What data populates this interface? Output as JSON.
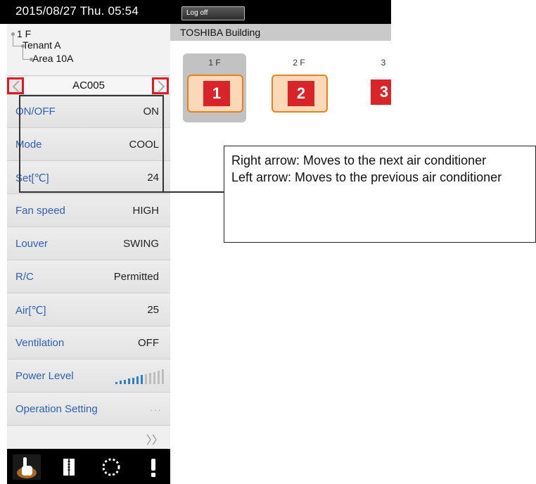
{
  "topbar": {
    "datetime": "2015/08/27  Thu.  05:54",
    "logoff_label": "Log off"
  },
  "tree": {
    "floor": "1 F",
    "tenant": "Tenant A",
    "area": "Area 10A"
  },
  "ac": {
    "name": "AC005",
    "prev_icon": "chevron-left-icon",
    "next_icon": "chevron-right-icon"
  },
  "rows": [
    {
      "label": "ON/OFF",
      "value": "ON"
    },
    {
      "label": "Mode",
      "value": "COOL"
    },
    {
      "label": "Set[℃]",
      "value": "24"
    },
    {
      "label": "Fan speed",
      "value": "HIGH"
    },
    {
      "label": "Louver",
      "value": "SWING"
    },
    {
      "label": "R/C",
      "value": "Permitted"
    },
    {
      "label": "Air[℃]",
      "value": "25"
    },
    {
      "label": "Ventilation",
      "value": "OFF"
    },
    {
      "label": "Power Level",
      "value": ""
    },
    {
      "label": "Operation Setting",
      "value": "···"
    }
  ],
  "power_level": {
    "level": 0.55,
    "bars": 12
  },
  "more_label": "〉〉",
  "footer": {
    "icons": [
      "hand-pointer-icon",
      "schedule-book-icon",
      "refresh-circle-icon",
      "alert-icon"
    ]
  },
  "building": {
    "name": "TOSHIBA Building",
    "floors": [
      {
        "label": "1 F",
        "number": "1",
        "selected": true
      },
      {
        "label": "2 F",
        "number": "2",
        "selected": false
      },
      {
        "label": "3",
        "number": "3",
        "selected": false
      }
    ]
  },
  "callout": {
    "line1": "Right arrow: Moves to the next air conditioner",
    "line2": "Left arrow: Moves to the previous air conditioner"
  },
  "colors": {
    "accent_red": "#d9242a",
    "tile_orange": "#e8801e",
    "label_blue": "#2f5fb5"
  }
}
